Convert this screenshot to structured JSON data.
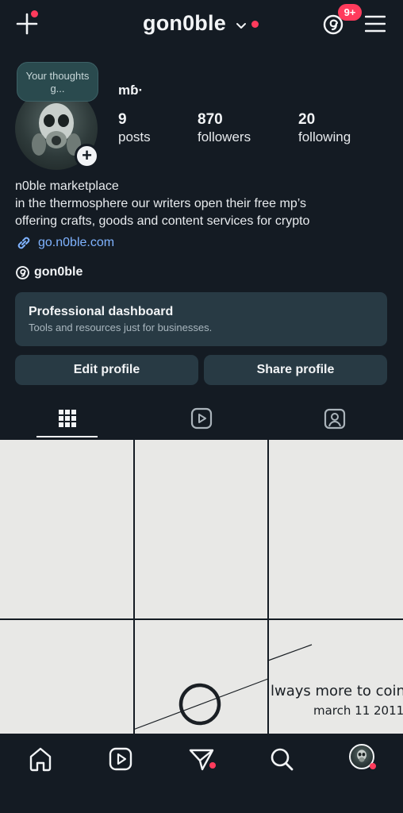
{
  "header": {
    "username": "gon0ble",
    "notification_badge": "9+"
  },
  "profile": {
    "note": "Your thoughts g...",
    "display_name": "mɓ·",
    "stats": [
      {
        "value": "9",
        "label": "posts"
      },
      {
        "value": "870",
        "label": "followers"
      },
      {
        "value": "20",
        "label": "following"
      }
    ],
    "bio_lines": [
      "n0ble marketplace",
      "in the thermosphere our writers open their free mp’s",
      "offering crafts, goods and content services for crypto"
    ],
    "link": "go.n0ble.com",
    "threads_handle": "gon0ble"
  },
  "pro_dashboard": {
    "title": "Professional dashboard",
    "subtitle": "Tools and resources just for businesses."
  },
  "actions": {
    "edit_label": "Edit profile",
    "share_label": "Share profile"
  },
  "tabs": [
    {
      "icon": "grid-icon",
      "active": true
    },
    {
      "icon": "reels-icon",
      "active": false
    },
    {
      "icon": "tagged-icon",
      "active": false
    }
  ],
  "posts": {
    "caption_line1": "lways more to coin",
    "caption_line2": "march 11 2011"
  },
  "bottom_nav": [
    "home-icon",
    "reels-icon",
    "messages-icon",
    "search-icon",
    "profile-avatar"
  ],
  "colors": {
    "background": "#141b23",
    "card": "#283a44",
    "accent_red": "#ff3b5c",
    "link_blue": "#7fb3ff"
  }
}
